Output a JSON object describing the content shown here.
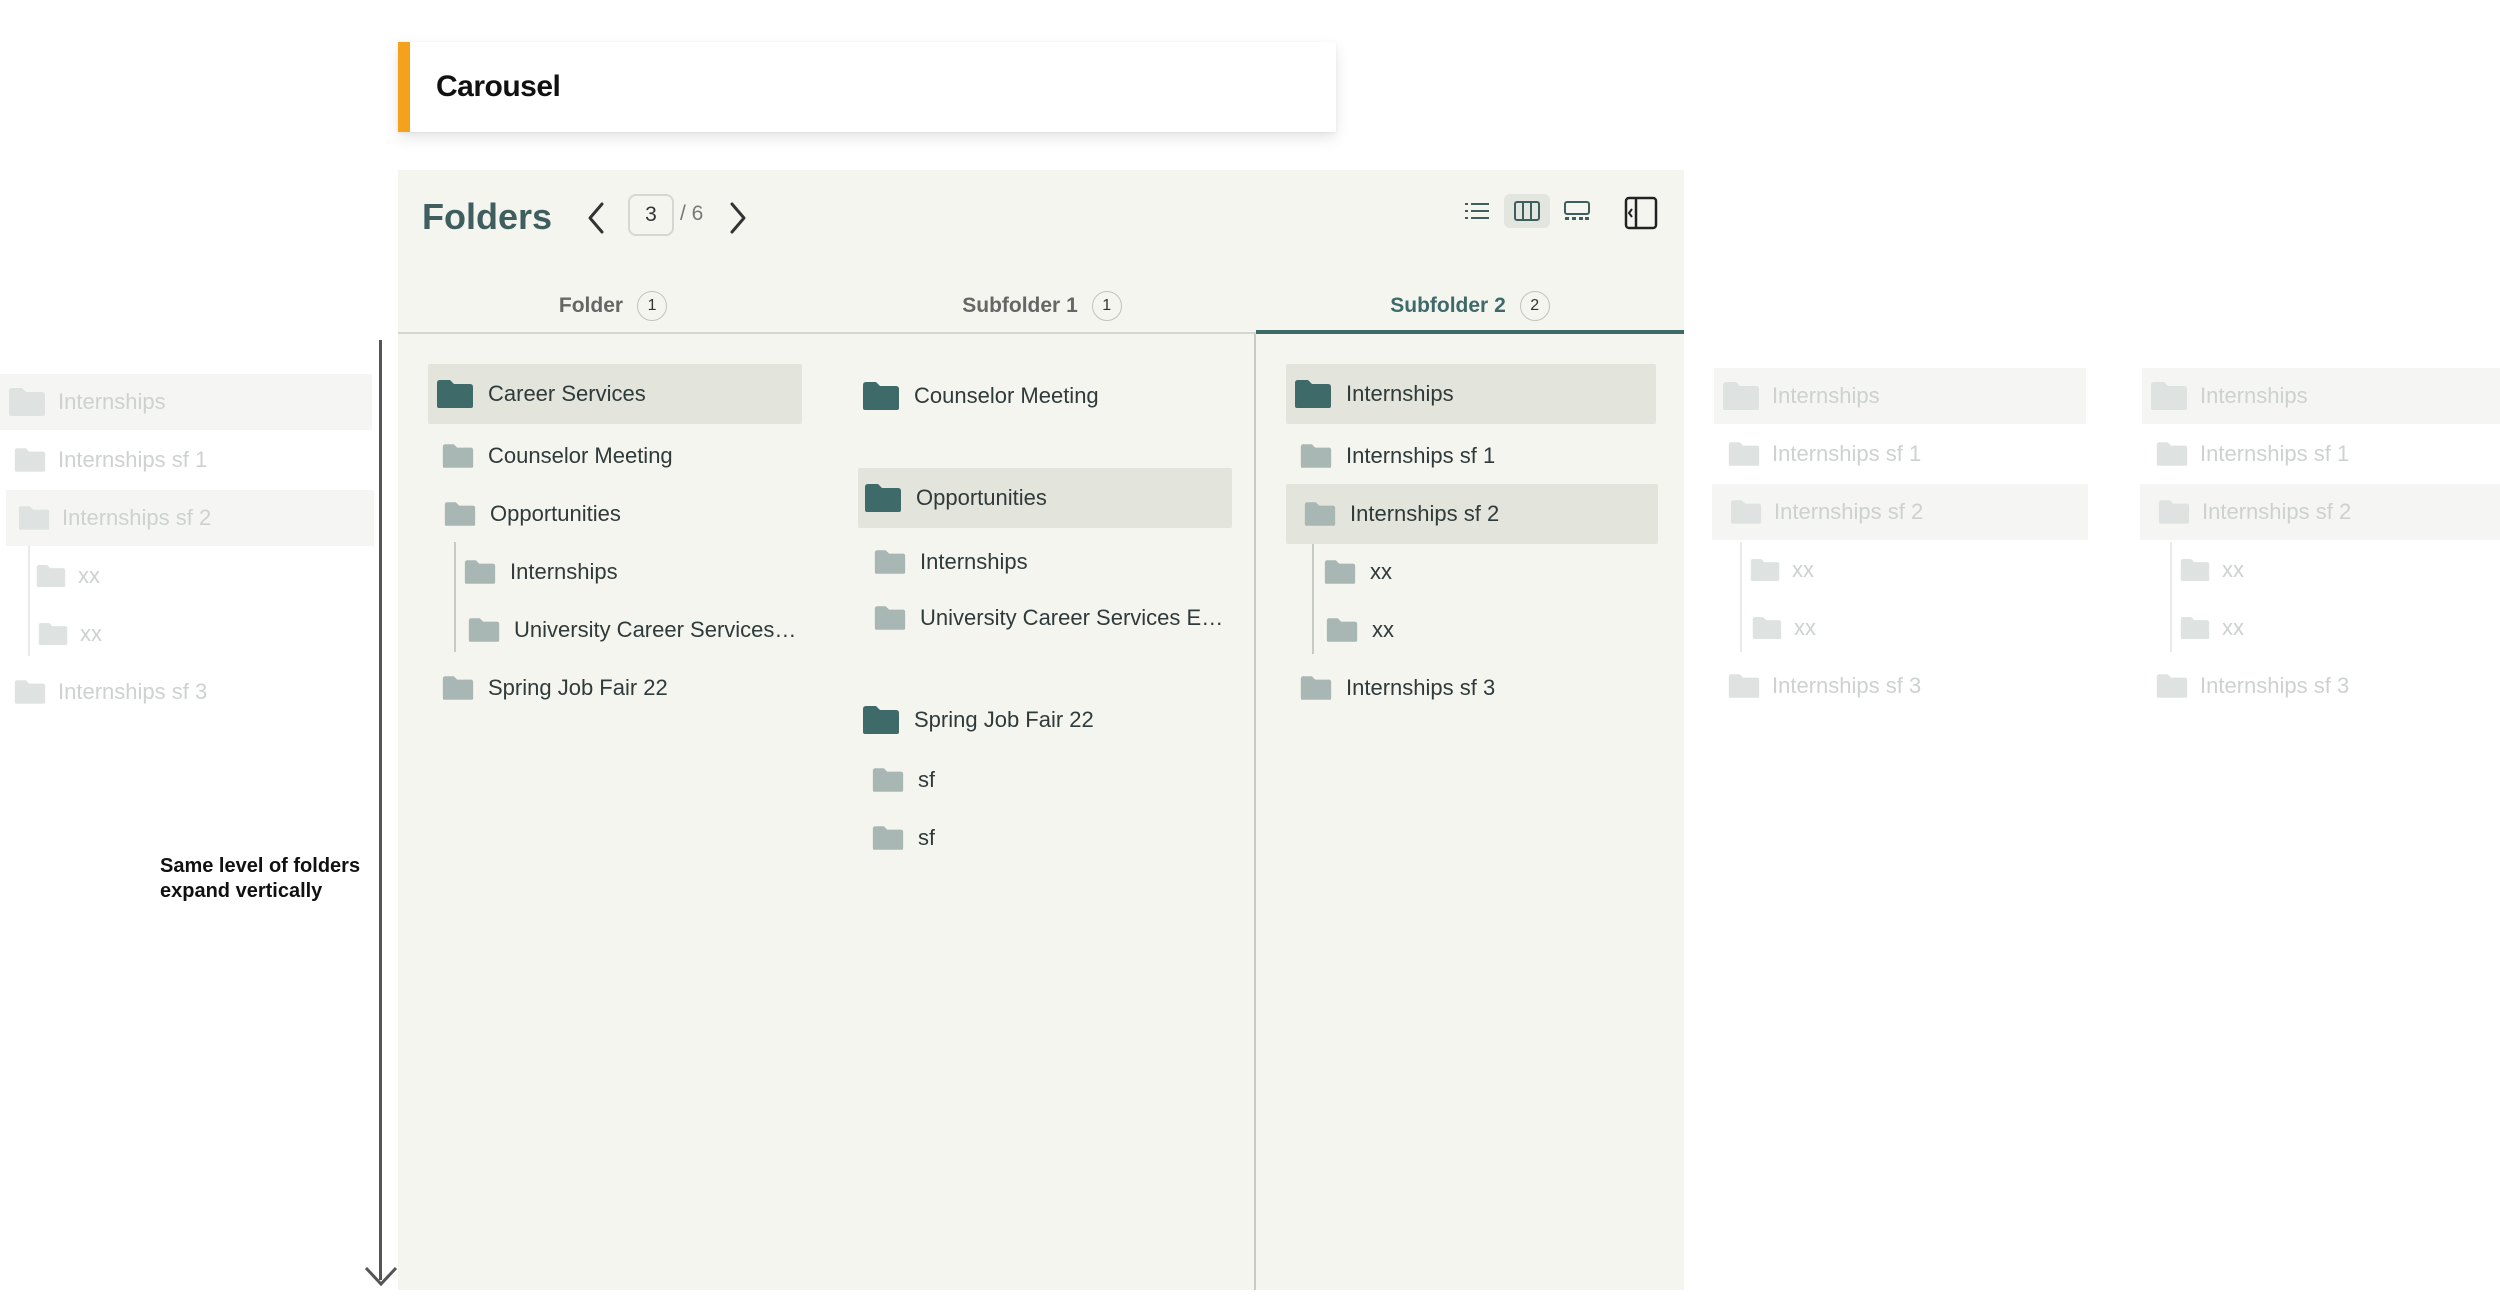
{
  "carousel": {
    "title": "Carousel"
  },
  "panel": {
    "title": "Folders",
    "pager": {
      "current": "3",
      "total": "/ 6"
    }
  },
  "tabs": [
    {
      "label": "Folder",
      "count": "1"
    },
    {
      "label": "Subfolder 1",
      "count": "1"
    },
    {
      "label": "Subfolder 2",
      "count": "2"
    }
  ],
  "col1": [
    "Career Services",
    "Counselor Meeting",
    "Opportunities",
    "Internships",
    "University Career Services…",
    "Spring Job Fair 22"
  ],
  "col2": [
    "Counselor Meeting",
    "Opportunities",
    "Internships",
    "University Career Services E…",
    "Spring Job Fair 22",
    "sf",
    "sf"
  ],
  "col3": [
    "Internships",
    "Internships sf 1",
    "Internships sf 2",
    "xx",
    "xx",
    "Internships sf 3"
  ],
  "faded": [
    "Internships",
    "Internships sf 1",
    "Internships sf 2",
    "xx",
    "xx",
    "Internships sf 3"
  ],
  "annotation": {
    "line1": "Same level of folders",
    "line2": "expand vertically"
  },
  "colors": {
    "accent": "#f4a21c",
    "folder_dark": "#3f6a6a",
    "folder_light": "#a9b7b4",
    "panel_bg": "#f5f5f0"
  },
  "icons": [
    "folder-icon",
    "chevron-left-icon",
    "chevron-right-icon",
    "list-view-icon",
    "column-view-icon",
    "gallery-view-icon",
    "panel-toggle-icon",
    "arrow-down-icon"
  ]
}
